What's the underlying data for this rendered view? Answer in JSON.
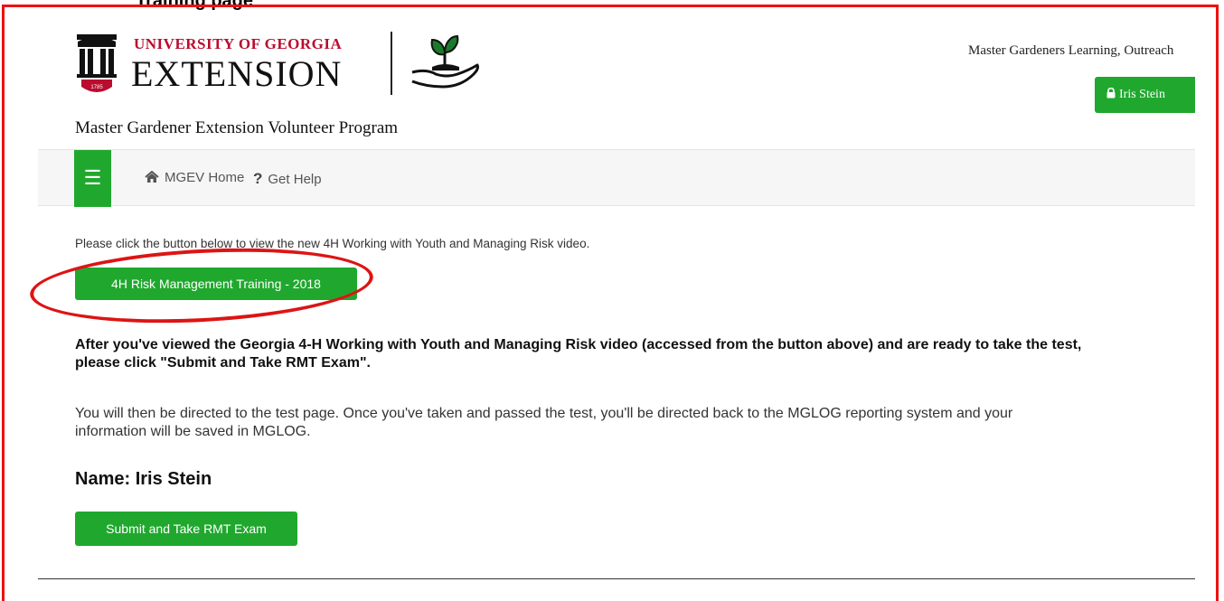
{
  "caption": "Training page",
  "header": {
    "university": "UNIVERSITY OF GEORGIA",
    "unit": "EXTENSION",
    "seal_year": "1785",
    "program_title": "Master Gardener Extension Volunteer Program",
    "site_title": "Master Gardeners Learning, Outreach",
    "user_button": "Iris Stein",
    "user_button_icon": "lock-icon"
  },
  "navbar": {
    "menu_icon": "hamburger-menu-icon",
    "home_label": "MGEV Home",
    "home_icon": "home-icon",
    "help_label": "Get Help",
    "help_icon": "question-icon"
  },
  "main": {
    "intro": "Please click the button below to view the new 4H Working with Youth and Managing Risk video.",
    "rmt_button": "4H Risk Management Training - 2018",
    "instructions_line1": "After you've viewed the Georgia 4-H Working with Youth and Managing Risk video (accessed from the button above) and are ready to take the test,",
    "instructions_line2": "please click \"Submit and Take RMT Exam\".",
    "direction_line1": "You will then be directed to the test page. Once you've taken and passed the test, you'll be directed back to the MGLOG reporting system and your",
    "direction_line2": "information will be saved in MGLOG.",
    "name_label": "Name:",
    "name_value": "Iris Stein",
    "submit_button": "Submit and Take RMT Exam"
  },
  "colors": {
    "brand_green": "#20a82e",
    "uga_red": "#ba0c2f",
    "annotation_red": "#ee1111"
  }
}
